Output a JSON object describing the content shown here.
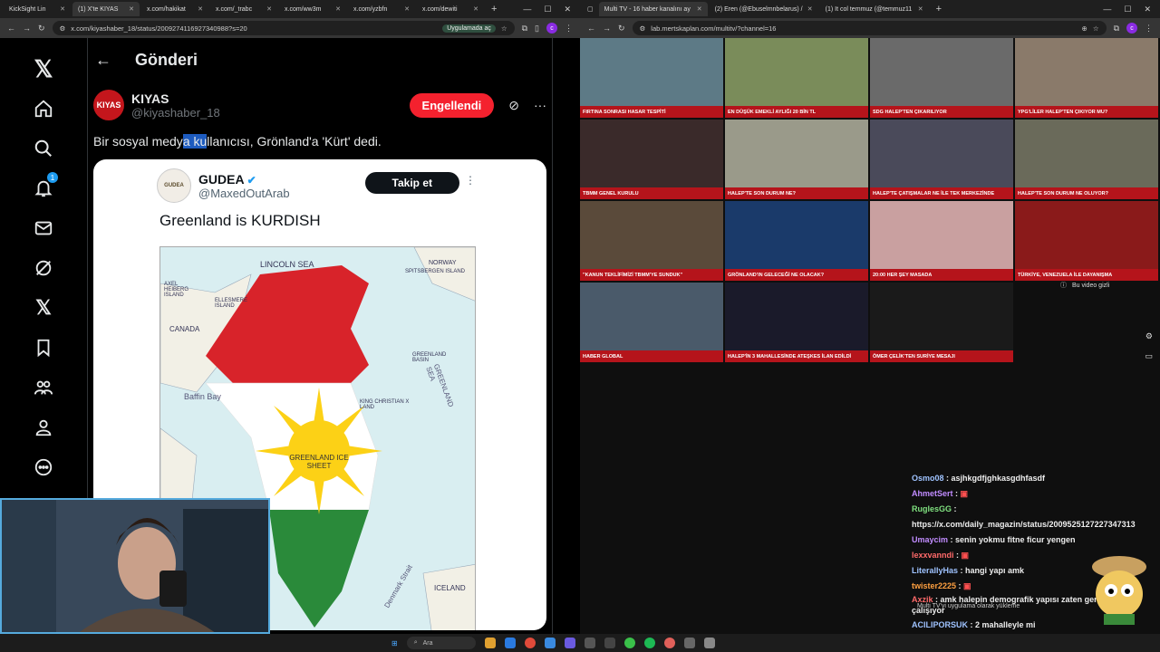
{
  "left_browser": {
    "tabs": [
      {
        "label": "KickSight Lin"
      },
      {
        "label": "(1) X'te KIYAS"
      },
      {
        "label": "x.com/hakikat"
      },
      {
        "label": "x.com/_trabc"
      },
      {
        "label": "x.com/ww3m"
      },
      {
        "label": "x.com/yzbfn"
      },
      {
        "label": "x.com/dewiti"
      }
    ],
    "url": "x.com/kiyashaber_18/status/2009274116927340988?s=20",
    "app_pill": "Uygulamada aç"
  },
  "twitter": {
    "page_title": "Gönderi",
    "notification_count": "1",
    "author": {
      "avatar_text": "KIYAS",
      "name": "KIYAS",
      "handle": "@kiyashaber_18",
      "blocked_label": "Engellendi"
    },
    "tweet_text_pre": "Bir sosyal medya ",
    "tweet_text_hl": "a ku",
    "tweet_text_post": "llanıcısı, Grönland'a 'Kürt' dedi.",
    "tweet_text_prefix": "Bir sosyal medy",
    "quote": {
      "avatar_text": "GUDEA",
      "name": "GUDEA",
      "handle": "@MaxedOutArab",
      "follow_label": "Takip et",
      "text": "Greenland is KURDISH",
      "map_labels": {
        "lincoln": "LINCOLN SEA",
        "norway": "NORWAY",
        "spitsbergen": "SPITSBERGEN ISLAND",
        "axel": "AXEL HEIBERG ISLAND",
        "ellesmere": "ELLESMERE ISLAND",
        "canada": "CANADA",
        "baffin": "Baffin Bay",
        "ice_sheet": "GREENLAND ICE SHEET",
        "greenland_sea": "GREENLAND SEA",
        "greenland_basin": "GREENLAND BASIN",
        "iceland": "ICELAND",
        "denmark": "Denmark Strait",
        "king_christian": "KING CHRISTIAN X LAND"
      }
    }
  },
  "right_browser": {
    "tabs": [
      {
        "label": "Multi TV - 16 haber kanalını ay"
      },
      {
        "label": "(2) Eren (@Ebuselmnbelarus) /"
      },
      {
        "label": "(1) It col temmuz (@temmuz11"
      }
    ],
    "url": "lab.mertskaplan.com/multitv/?channel=16"
  },
  "tv_grid": [
    {
      "caption": "FIRTINA SONRASI HASAR TESPİTİ",
      "bg": "#5d7a86"
    },
    {
      "caption": "EN DÜŞÜK EMEKLİ AYLIĞI 20 BİN TL",
      "bg": "#7a8c5a"
    },
    {
      "caption": "SDG HALEP'TEN ÇIKARILIYOR",
      "bg": "#6a6a6a"
    },
    {
      "caption": "YPG'LİLER HALEP'TEN ÇIKIYOR MU?",
      "bg": "#8a7a6a"
    },
    {
      "caption": "TBMM GENEL KURULU",
      "bg": "#3a2a2a"
    },
    {
      "caption": "HALEP'TE SON DURUM NE?",
      "bg": "#9a9a8a"
    },
    {
      "caption": "HALEP'TE ÇATIŞMALAR NE İLE TEK MERKEZİNDE",
      "bg": "#4a4a5a"
    },
    {
      "caption": "HALEP'TE SON DURUM NE OLUYOR?",
      "bg": "#6a6a5a"
    },
    {
      "caption": "\"KANUN TEKLİFİMİZİ TBMM'YE SUNDUK\"",
      "bg": "#5a4a3a"
    },
    {
      "caption": "GRÖNLAND'IN GELECEĞİ NE OLACAK?",
      "bg": "#1a3a6a"
    },
    {
      "caption": "20:00 HER ŞEY MASADA",
      "bg": "#c9a0a0"
    },
    {
      "caption": "TÜRKİYE, VENEZUELA İLE DAYANIŞMA",
      "bg": "#8a1a1a"
    },
    {
      "caption": "HABER GLOBAL",
      "bg": "#4a5a6a"
    },
    {
      "caption": "HALEP'İN 3 MAHALLESİNDE ATEŞKES İLAN EDİLDİ",
      "bg": "#1a1a2a"
    },
    {
      "caption": "ÖMER ÇELİK'TEN SURİYE MESAJI",
      "bg": "#1a1a1a"
    }
  ],
  "hidden_video_label": "Bu video gizli",
  "chat": [
    {
      "user": "Osmo08",
      "color": "#9fc3ff",
      "msg": "asjhkgdfjghkasgdhfasdf"
    },
    {
      "user": "AhmetSert",
      "color": "#c18cff",
      "msg": ""
    },
    {
      "user": "RuglesGG",
      "color": "#7fe07f",
      "msg": ""
    },
    {
      "user": "",
      "color": "#eee",
      "msg": "https://x.com/daily_magazin/status/2009525127227347313"
    },
    {
      "user": "Umaycim",
      "color": "#c18cff",
      "msg": "senin yokmu fitne ficur yengen"
    },
    {
      "user": "lexxvanndi",
      "color": "#ff6a6a",
      "msg": ""
    },
    {
      "user": "LiterallyHas",
      "color": "#9fc3ff",
      "msg": "hangi yapı amk"
    },
    {
      "user": "twister2225",
      "color": "#ffa040",
      "msg": ""
    },
    {
      "user": "Axzik",
      "color": "#ff6a6a",
      "msg": "amk halepin demografik yapısı zaten geri alıyala çalışıyor"
    },
    {
      "user": "ACILIPORSUK",
      "color": "#9fc3ff",
      "msg": "2 mahalleyle mi"
    }
  ],
  "chat_overlay": "Multi TV'yi uygulama olarak yükleme",
  "taskbar": {
    "search_placeholder": "Ara"
  }
}
